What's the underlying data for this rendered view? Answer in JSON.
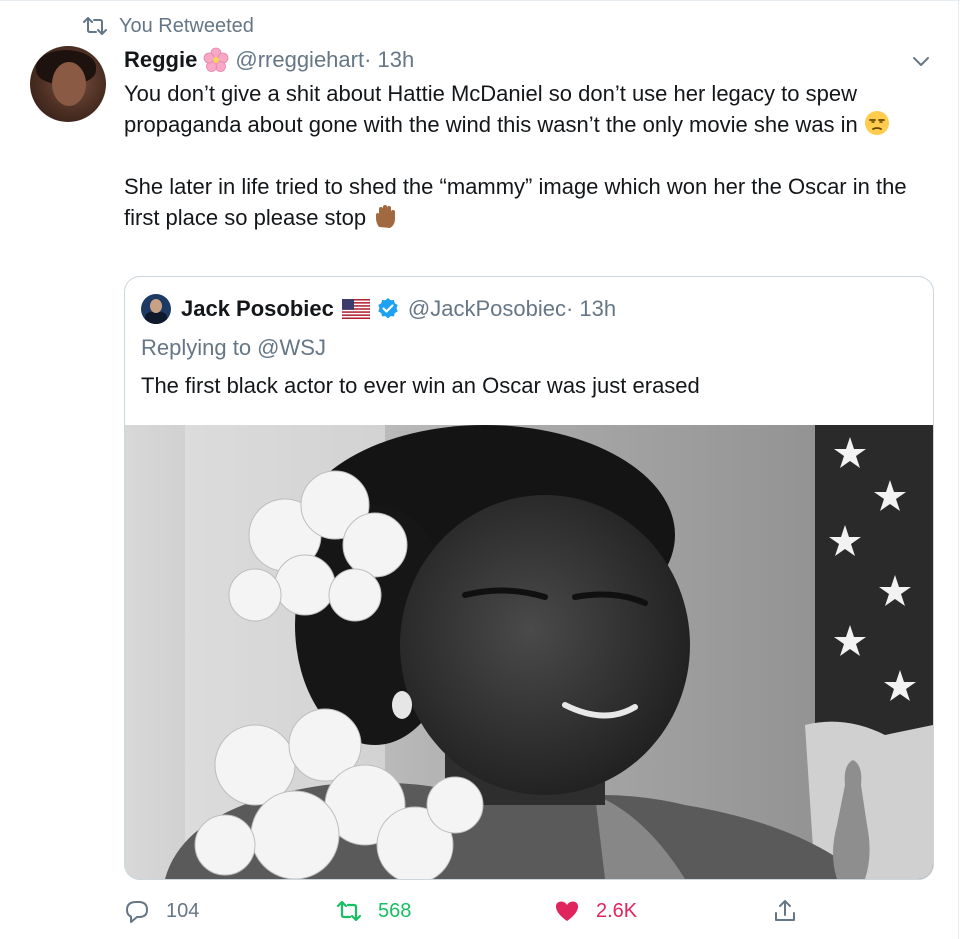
{
  "context": {
    "label": "You Retweeted",
    "retweet_icon": "retweet-icon"
  },
  "tweet": {
    "avatar_icon": "avatar",
    "display_name": "Reggie",
    "name_emoji": "cherry-blossom-icon",
    "handle": "@rreggiehart",
    "time": " · 13h",
    "menu_icon": "chevron-down-icon",
    "paragraph1": "You don’t give a shit about Hattie McDaniel so don’t use her legacy to spew propaganda about gone with the wind this wasn’t the only movie she was in",
    "paragraph1_emoji": "unamused-face-icon",
    "paragraph2": "She later in life tried to shed the “mammy” image which won her the Oscar in the first place so please stop",
    "paragraph2_emoji": "raised-hand-icon"
  },
  "quoted_tweet": {
    "display_name": "Jack Posobiec",
    "name_emoji": "us-flag-icon",
    "verified_icon": "verified-icon",
    "handle": "@JackPosobiec",
    "time": " · 13h",
    "replying_to": "Replying to @WSJ",
    "text": "The first black actor to ever win an Oscar was just erased",
    "media": "black-and-white-photo"
  },
  "actions": {
    "reply_count": "104",
    "retweet_count": "568",
    "like_count": "2.6K",
    "reply_icon": "reply-icon",
    "retweet_icon": "retweet-icon",
    "like_icon": "heart-icon",
    "share_icon": "share-icon"
  },
  "colors": {
    "text": "#14171a",
    "secondary": "#657786",
    "border": "#ccd6dd",
    "retweet_green": "#17bf63",
    "like_red": "#e0245e",
    "verified_blue": "#1da1f2"
  }
}
